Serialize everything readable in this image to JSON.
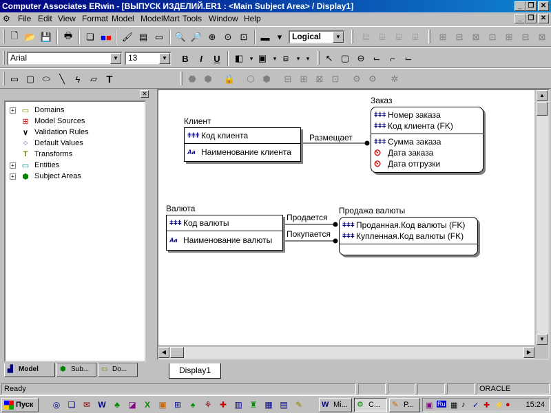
{
  "window": {
    "title": "Computer Associates ERwin - [ВЫПУСК ИЗДЕЛИЙ.ER1 : <Main Subject Area> / Display1]",
    "controls": [
      "_",
      "❐",
      "✕"
    ]
  },
  "menu": {
    "items": [
      "File",
      "Edit",
      "View",
      "Format",
      "Model",
      "ModelMart",
      "Tools",
      "Window",
      "Help"
    ]
  },
  "toolbar1": {
    "view_mode": "Logical"
  },
  "toolbar2": {
    "font": "Arial",
    "size": "13",
    "bold": "B",
    "italic": "I",
    "underline": "U"
  },
  "toolbar3": {
    "text_tool": "T"
  },
  "tree": {
    "items": [
      {
        "label": "Domains",
        "icon": "domains-icon",
        "expandable": true
      },
      {
        "label": "Model Sources",
        "icon": "model-sources-icon",
        "expandable": false
      },
      {
        "label": "Validation Rules",
        "icon": "validation-rules-icon",
        "expandable": false
      },
      {
        "label": "Default Values",
        "icon": "default-values-icon",
        "expandable": false
      },
      {
        "label": "Transforms",
        "icon": "transforms-icon",
        "expandable": false
      },
      {
        "label": "Entities",
        "icon": "entities-icon",
        "expandable": true
      },
      {
        "label": "Subject Areas",
        "icon": "subject-areas-icon",
        "expandable": true
      }
    ],
    "tabs": [
      "Model",
      "Sub...",
      "Do..."
    ]
  },
  "diagram": {
    "entities": [
      {
        "name": "Клиент",
        "keys": [
          "Код клиента"
        ],
        "attrs": [
          "Наименование клиента"
        ]
      },
      {
        "name": "Заказ",
        "keys": [
          "Номер заказа",
          "Код клиента (FK)"
        ],
        "attrs": [
          "Сумма заказа",
          "Дата заказа",
          "Дата отгрузки"
        ]
      },
      {
        "name": "Валюта",
        "keys": [
          "Код валюты"
        ],
        "attrs": [
          "Наименование валюты"
        ]
      },
      {
        "name": "Продажа валюты",
        "keys": [
          "Проданная.Код валюты (FK)",
          "Купленная.Код валюты (FK)"
        ],
        "attrs": []
      }
    ],
    "relationships": [
      "Размещает",
      "Продается",
      "Покупается"
    ]
  },
  "doc_tab": "Display1",
  "status": {
    "text": "Ready",
    "db": "ORACLE"
  },
  "taskbar": {
    "start": "Пуск",
    "tasks": [
      "Mi...",
      "C...",
      "P..."
    ],
    "clock": "15:24",
    "lang": "Ru"
  }
}
